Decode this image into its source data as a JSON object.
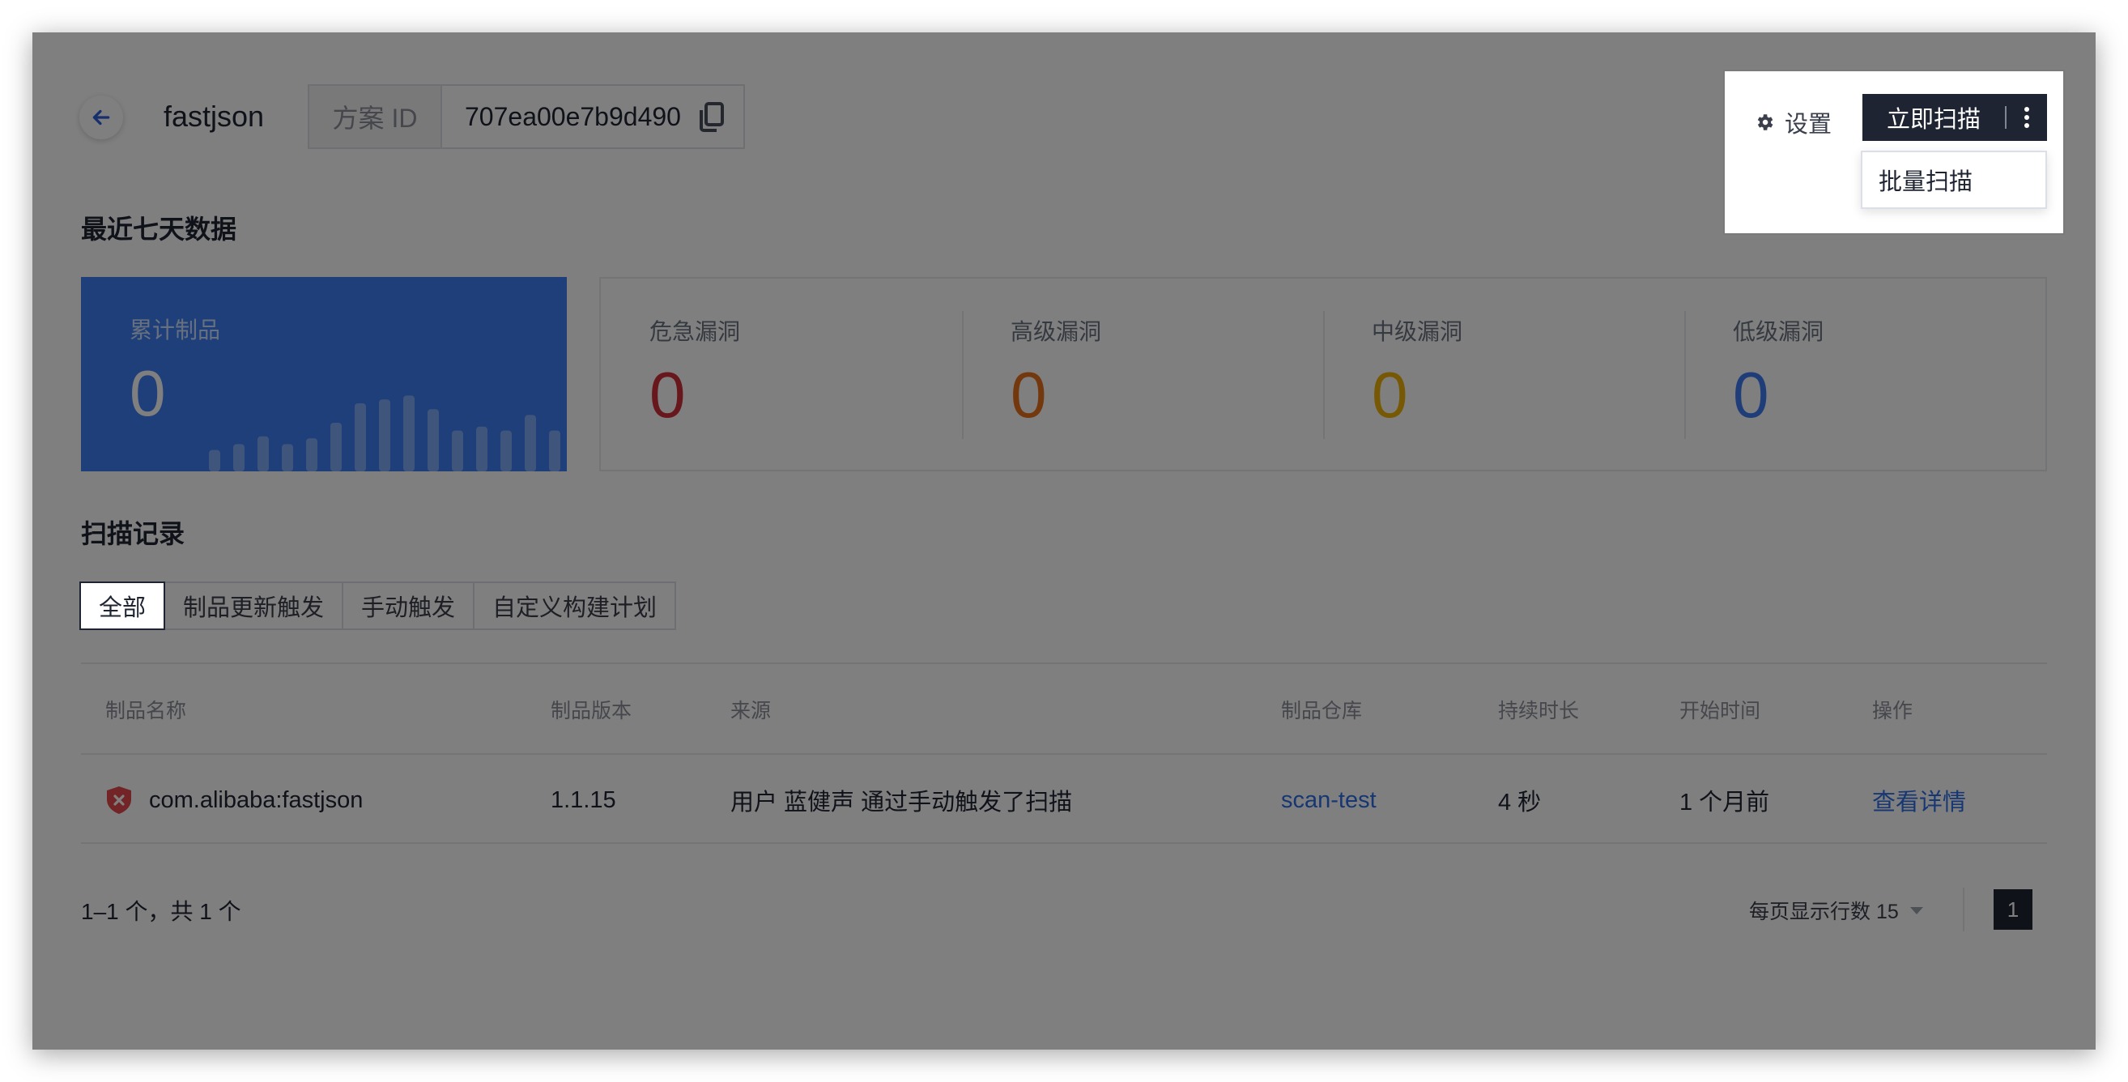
{
  "header": {
    "project_name": "fastjson",
    "plan_id_label": "方案 ID",
    "plan_id_value": "707ea00e7b9d490"
  },
  "toolbar": {
    "settings_label": "设置",
    "scan_now_label": "立即扫描",
    "dropdown": {
      "batch_scan_label": "批量扫描"
    }
  },
  "stats": {
    "title": "最近七天数据",
    "total": {
      "label": "累计制品",
      "value": "0"
    },
    "cards": [
      {
        "label": "危急漏洞",
        "value": "0",
        "color": "#d0303a"
      },
      {
        "label": "高级漏洞",
        "value": "0",
        "color": "#e8711f"
      },
      {
        "label": "中级漏洞",
        "value": "0",
        "color": "#efb008"
      },
      {
        "label": "低级漏洞",
        "value": "0",
        "color": "#3f7cf2"
      }
    ],
    "sparkline": [
      0.22,
      0.28,
      0.36,
      0.28,
      0.34,
      0.5,
      0.7,
      0.74,
      0.78,
      0.64,
      0.42,
      0.46,
      0.42,
      0.58,
      0.42
    ]
  },
  "records": {
    "title": "扫描记录",
    "tabs": [
      "全部",
      "制品更新触发",
      "手动触发",
      "自定义构建计划"
    ],
    "columns": [
      "制品名称",
      "制品版本",
      "来源",
      "制品仓库",
      "持续时长",
      "开始时间",
      "操作"
    ],
    "rows": [
      {
        "name": "com.alibaba:fastjson",
        "version": "1.1.15",
        "source": "用户 蓝健声 通过手动触发了扫描",
        "repo": "scan-test",
        "duration": "4 秒",
        "start": "1 个月前",
        "action": "查看详情"
      }
    ]
  },
  "pagination": {
    "summary": "1–1 个，共 1 个",
    "per_page_label": "每页显示行数 15",
    "current_page": "1"
  }
}
